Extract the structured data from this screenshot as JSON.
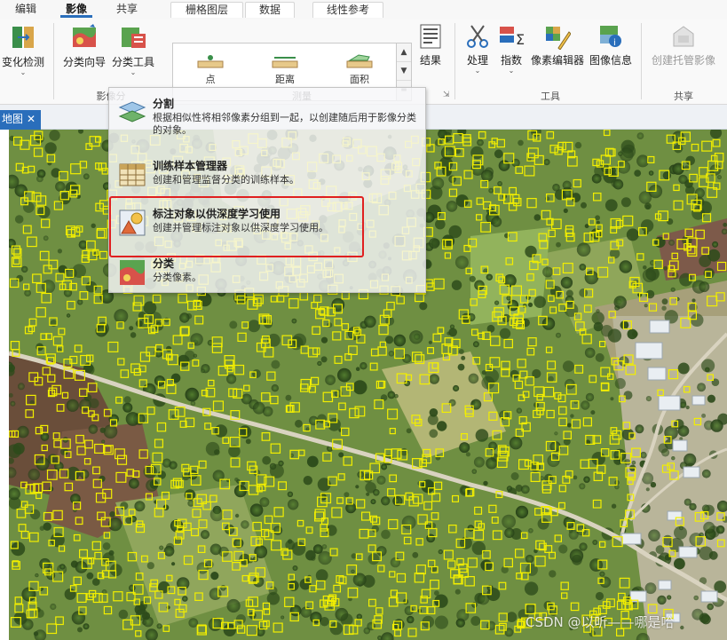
{
  "tabs": [
    "编辑",
    "影像",
    "共享",
    "栅格图层",
    "数据",
    "线性参考"
  ],
  "ribbon": {
    "change_detection": "变化检测",
    "classify_wizard": "分类向导",
    "classify_tools": "分类工具",
    "group_imagery": "影像分",
    "gallery": {
      "point": "点",
      "distance": "距离",
      "area": "面积"
    },
    "group_measure": "测量",
    "results": "结果",
    "process": "处理",
    "indices": "指数",
    "pixel_editor": "像素编辑器",
    "image_info": "图像信息",
    "group_tools": "工具",
    "create_hosted_imagery": "创建托管影像",
    "group_share": "共享"
  },
  "map_tab": {
    "label": "地图",
    "close": "✕"
  },
  "dropdown": {
    "items": [
      {
        "title": "分割",
        "desc": "根据相似性将相邻像素分组到一起，以创建随后用于影像分类的对象。"
      },
      {
        "title": "训练样本管理器",
        "desc": "创建和管理监督分类的训练样本。"
      },
      {
        "title": "标注对象以供深度学习使用",
        "desc": "创建并管理标注对象以供深度学习使用。"
      },
      {
        "title": "分类",
        "desc": "分类像素。"
      }
    ]
  },
  "watermark": "CSDN @以听——哪是哈",
  "colors": {
    "accent": "#2a6ebb",
    "highlight": "#e02020",
    "annotation_box": "#f2ee00"
  }
}
